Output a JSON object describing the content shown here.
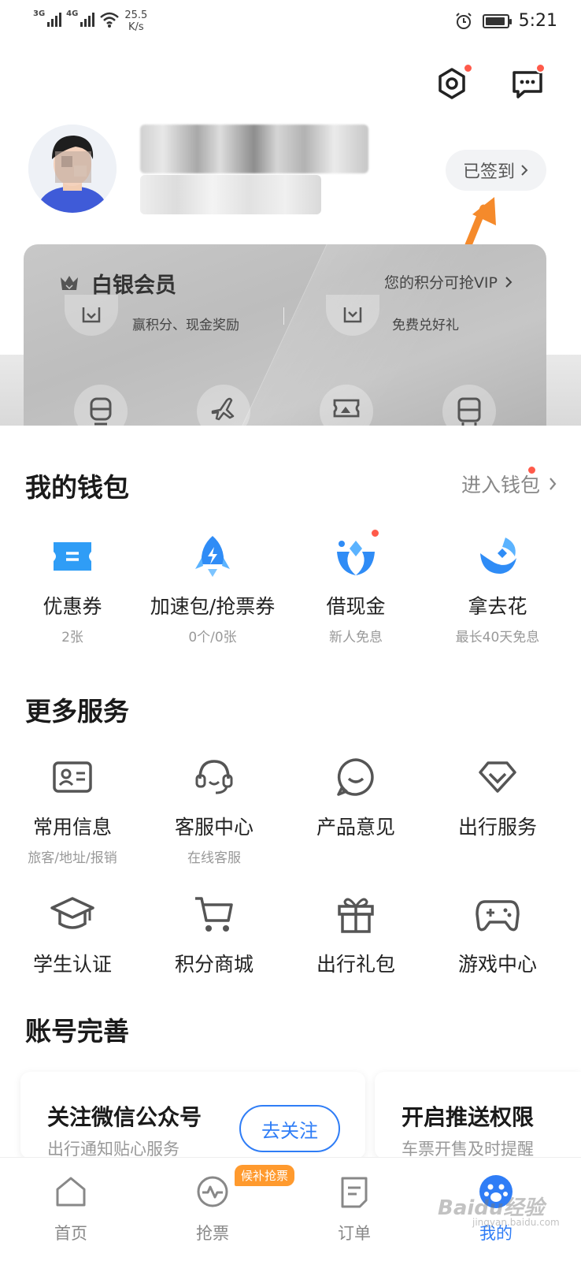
{
  "status_bar": {
    "signal1": "3G",
    "signal2": "4G",
    "speed_value": "25.5",
    "speed_unit": "K/s",
    "time": "5:21"
  },
  "profile": {
    "signin_label": "已签到"
  },
  "member_card": {
    "level": "白银会员",
    "vip_text": "您的积分可抢VIP",
    "benefit_left": "赢积分、现金奖励",
    "benefit_right": "免费兑好礼"
  },
  "wallet": {
    "title": "我的钱包",
    "enter_label": "进入钱包",
    "items": [
      {
        "label": "优惠券",
        "sub": "2张",
        "icon": "coupon-icon"
      },
      {
        "label": "加速包/抢票券",
        "sub": "0个/0张",
        "icon": "rocket-icon"
      },
      {
        "label": "借现金",
        "sub": "新人免息",
        "icon": "cash-loan-icon"
      },
      {
        "label": "拿去花",
        "sub": "最长40天免息",
        "icon": "credit-icon"
      }
    ]
  },
  "services": {
    "title": "更多服务",
    "items": [
      {
        "label": "常用信息",
        "sub": "旅客/地址/报销",
        "icon": "id-card-icon"
      },
      {
        "label": "客服中心",
        "sub": "在线客服",
        "icon": "headset-icon"
      },
      {
        "label": "产品意见",
        "sub": "",
        "icon": "feedback-icon"
      },
      {
        "label": "出行服务",
        "sub": "",
        "icon": "diamond-icon"
      },
      {
        "label": "学生认证",
        "sub": "",
        "icon": "graduation-cap-icon"
      },
      {
        "label": "积分商城",
        "sub": "",
        "icon": "cart-icon"
      },
      {
        "label": "出行礼包",
        "sub": "",
        "icon": "gift-icon"
      },
      {
        "label": "游戏中心",
        "sub": "",
        "icon": "gamepad-icon"
      }
    ]
  },
  "account": {
    "title": "账号完善",
    "cards": [
      {
        "title": "关注微信公众号",
        "sub": "出行通知贴心服务",
        "button": "去关注"
      },
      {
        "title": "开启推送权限",
        "sub": "车票开售及时提醒"
      }
    ]
  },
  "tabbar": {
    "tabs": [
      {
        "label": "首页"
      },
      {
        "label": "抢票"
      },
      {
        "label": "订单"
      },
      {
        "label": "我的"
      }
    ],
    "badge": "候补抢票"
  },
  "watermark": {
    "text": "Baidu经验",
    "sub": "jingyan.baidu.com"
  },
  "colors": {
    "accent": "#2f7df6",
    "badge": "#ff9a2e",
    "dot": "#ff5a4a",
    "card": "#c4c4c4"
  }
}
